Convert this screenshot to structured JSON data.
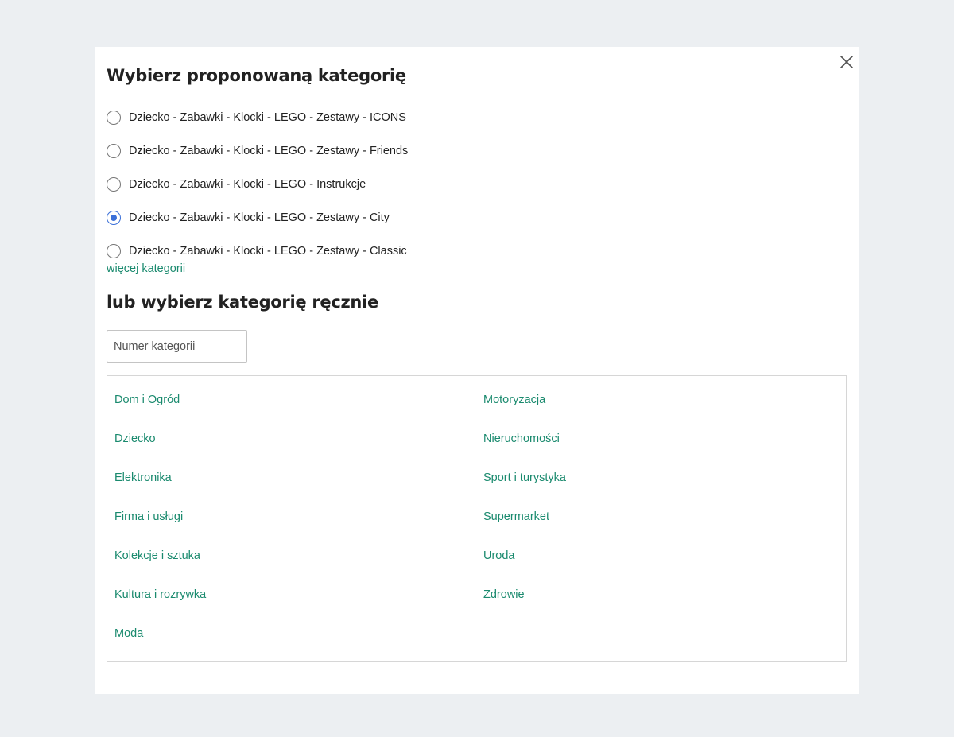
{
  "modal": {
    "title": "Wybierz proponowaną kategorię",
    "close_icon": "close-icon"
  },
  "suggestions": {
    "options": [
      {
        "label": "Dziecko - Zabawki - Klocki - LEGO - Zestawy - ICONS",
        "checked": false
      },
      {
        "label": "Dziecko - Zabawki - Klocki - LEGO - Zestawy - Friends",
        "checked": false
      },
      {
        "label": "Dziecko - Zabawki - Klocki - LEGO - Instrukcje",
        "checked": false
      },
      {
        "label": "Dziecko - Zabawki - Klocki - LEGO - Zestawy - City",
        "checked": true
      },
      {
        "label": "Dziecko - Zabawki - Klocki - LEGO - Zestawy - Classic",
        "checked": false
      }
    ],
    "more_link": "więcej kategorii"
  },
  "manual": {
    "title": "lub wybierz kategorię ręcznie",
    "input_placeholder": "Numer kategorii",
    "input_value": "",
    "categories_left": [
      "Dom i Ogród",
      "Dziecko",
      "Elektronika",
      "Firma i usługi",
      "Kolekcje i sztuka",
      "Kultura i rozrywka",
      "Moda"
    ],
    "categories_right": [
      "Motoryzacja",
      "Nieruchomości",
      "Sport i turystyka",
      "Supermarket",
      "Uroda",
      "Zdrowie"
    ]
  },
  "colors": {
    "link": "#1a8a6e",
    "radio_selected": "#3a6fd8",
    "background": "#eceff2"
  }
}
